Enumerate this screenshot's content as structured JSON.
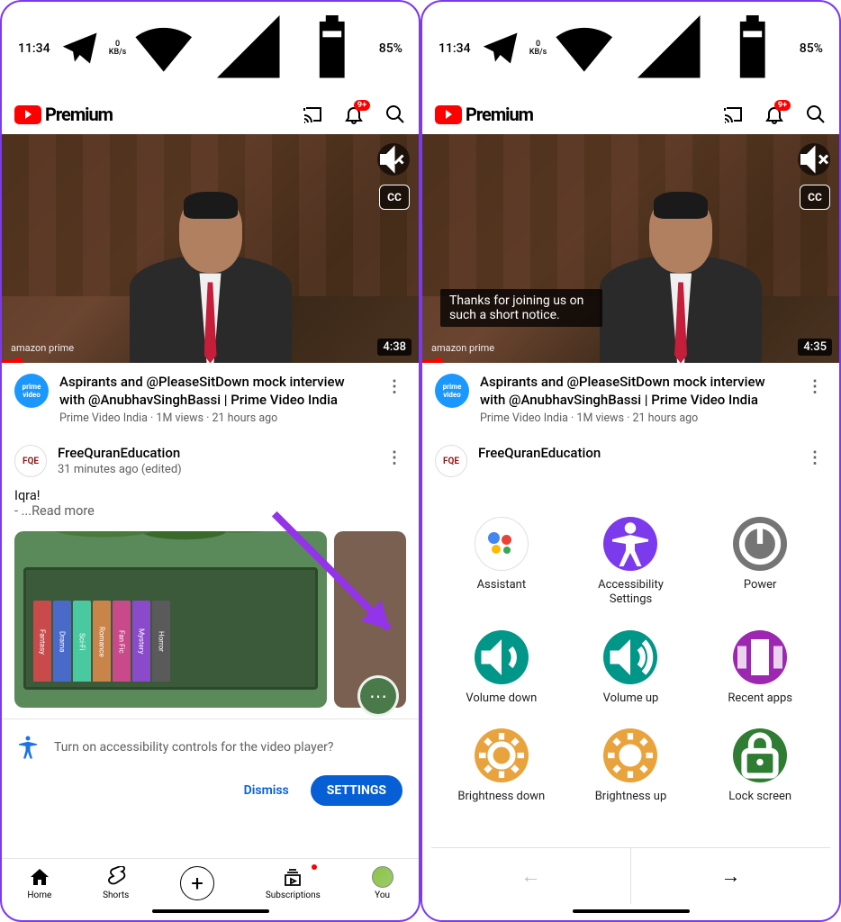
{
  "status": {
    "time": "11:34",
    "speed_num": "0",
    "speed_unit": "KB/s",
    "battery": "85%"
  },
  "header": {
    "brand": "Premium",
    "notif_badge": "9+"
  },
  "video": {
    "watermark": "amazon prime",
    "time_left": "4:38",
    "time_right": "4:35",
    "cc": "CC",
    "caption": "Thanks for joining us on such a short notice.",
    "title": "Aspirants and @PleaseSitDown mock interview with @AnubhavSinghBassi | Prime Video India",
    "sub": "Prime Video India · 1M views · 21 hours ago",
    "avatar": "prime video"
  },
  "post": {
    "channel": "FreeQuranEducation",
    "time": "31 minutes ago (edited)",
    "avatar": "FQE",
    "body": "Iqra!",
    "body2": "-  ...Read more",
    "books": [
      "Fantasy",
      "Drama",
      "Sci-Fi",
      "Romance",
      "Fan Fic",
      "Mystery",
      "Horror"
    ]
  },
  "a11y_prompt": {
    "text": "Turn on accessibility controls for the video player?",
    "dismiss": "Dismiss",
    "settings": "SETTINGS"
  },
  "nav": {
    "home": "Home",
    "shorts": "Shorts",
    "subs": "Subscriptions",
    "you": "You"
  },
  "panel": {
    "items": [
      {
        "label": "Assistant",
        "color": "#fff",
        "key": "assistant"
      },
      {
        "label": "Accessibility Settings",
        "color": "#7c3aed",
        "key": "a11y"
      },
      {
        "label": "Power",
        "color": "#757575",
        "key": "power"
      },
      {
        "label": "Volume down",
        "color": "#009688",
        "key": "voldown"
      },
      {
        "label": "Volume up",
        "color": "#009688",
        "key": "volup"
      },
      {
        "label": "Recent apps",
        "color": "#9c27b0",
        "key": "recent"
      },
      {
        "label": "Brightness down",
        "color": "#e8a33d",
        "key": "brightdown"
      },
      {
        "label": "Brightness up",
        "color": "#e8a33d",
        "key": "brightup"
      },
      {
        "label": "Lock screen",
        "color": "#2e7d32",
        "key": "lock"
      }
    ]
  }
}
